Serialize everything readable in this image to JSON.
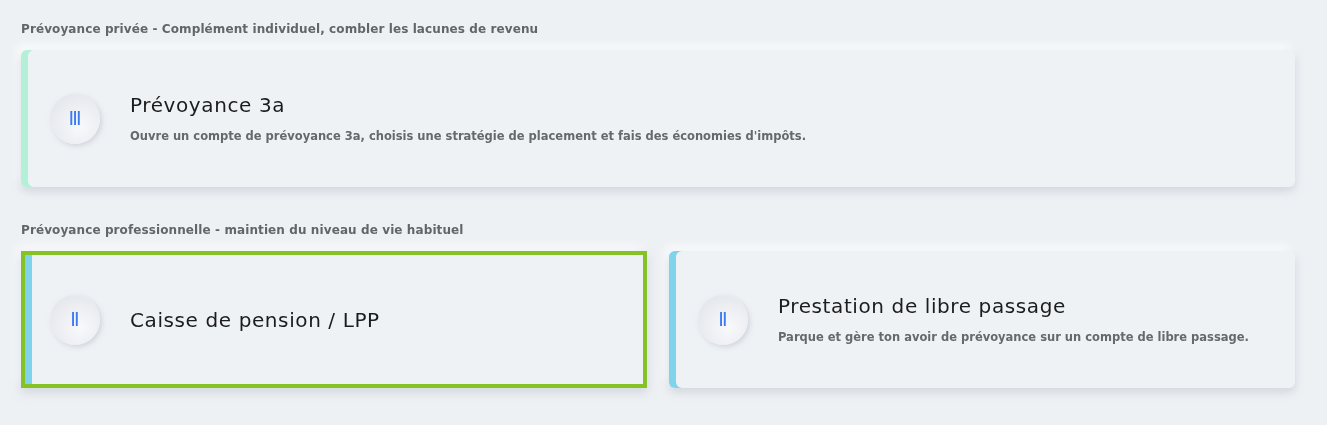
{
  "sections": [
    {
      "heading": "Prévoyance privée - Complément individuel, combler les lacunes de revenu",
      "cards": [
        {
          "numeral": "Ⅲ",
          "title": "Prévoyance 3a",
          "description": "Ouvre un compte de prévoyance 3a, choisis une stratégie de placement et fais des économies d'impôts.",
          "color": "#b4f0d8",
          "selected": false
        }
      ]
    },
    {
      "heading": "Prévoyance professionnelle - maintien du niveau de vie habituel",
      "cards": [
        {
          "numeral": "Ⅱ",
          "title": "Caisse de pension / LPP",
          "color": "#7fd3ea",
          "selected": true
        },
        {
          "numeral": "Ⅱ",
          "title": "Prestation de libre passage",
          "description": "Parque et gère ton avoir de prévoyance sur un compte de libre passage.",
          "color": "#7fd3ea",
          "selected": false
        }
      ]
    }
  ]
}
